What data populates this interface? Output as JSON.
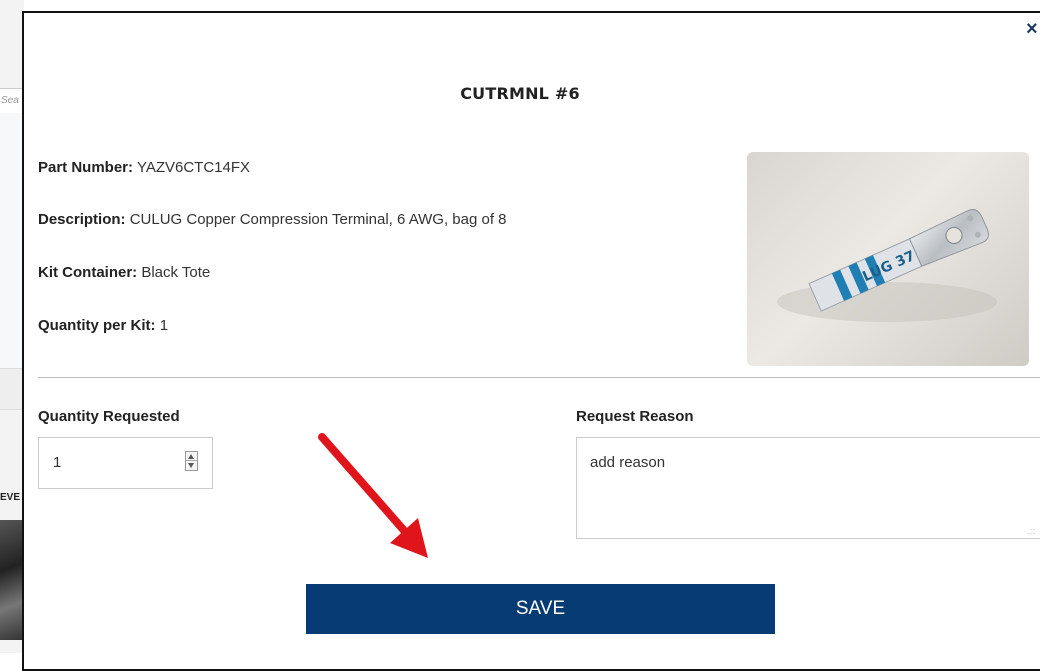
{
  "background": {
    "search_placeholder": "Sea",
    "label_fragment": "EVE"
  },
  "modal": {
    "close_symbol": "×",
    "title": "CUTRMNL #6",
    "part_number": {
      "label": "Part Number:",
      "value": "YAZV6CTC14FX"
    },
    "description": {
      "label": "Description:",
      "value": "CULUG Copper Compression Terminal, 6 AWG, bag of 8"
    },
    "kit_container": {
      "label": "Kit Container:",
      "value": "Black Tote"
    },
    "quantity_per_kit": {
      "label": "Quantity per Kit:",
      "value": "1"
    },
    "product_image_text": "LUG 37",
    "quantity_requested": {
      "label": "Quantity Requested",
      "value": "1"
    },
    "request_reason": {
      "label": "Request Reason",
      "value": "add reason"
    },
    "save_label": "SAVE"
  },
  "colors": {
    "primary": "#073b74",
    "annotation_arrow": "#e0151b",
    "lug_stripe": "#1f7fb5"
  }
}
